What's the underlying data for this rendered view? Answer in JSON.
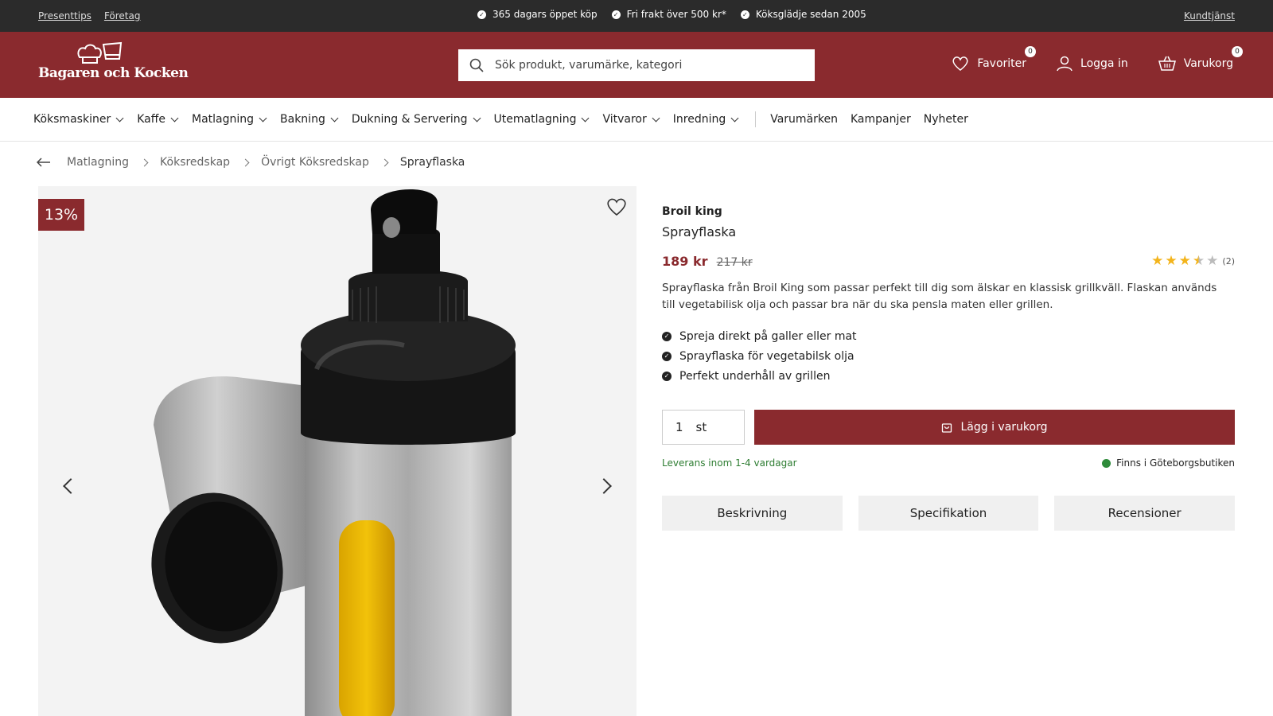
{
  "topbar": {
    "links_left": [
      "Presenttips",
      "Företag"
    ],
    "usps": [
      "365 dagars öppet köp",
      "Fri frakt över 500 kr*",
      "Köksglädje sedan 2005"
    ],
    "link_right": "Kundtjänst"
  },
  "header": {
    "logo_text": "Bagaren och Kocken",
    "search_placeholder": "Sök produkt, varumärke, kategori",
    "favorites_label": "Favoriter",
    "favorites_count": "0",
    "login_label": "Logga in",
    "cart_label": "Varukorg",
    "cart_count": "0"
  },
  "nav": {
    "categories": [
      "Köksmaskiner",
      "Kaffe",
      "Matlagning",
      "Bakning",
      "Dukning & Servering",
      "Utematlagning",
      "Vitvaror",
      "Inredning"
    ],
    "plain_links": [
      "Varumärken",
      "Kampanjer",
      "Nyheter"
    ]
  },
  "breadcrumb": [
    "Matlagning",
    "Köksredskap",
    "Övrigt Köksredskap",
    "Sprayflaska"
  ],
  "gallery": {
    "discount_badge": "13%"
  },
  "product": {
    "brand": "Broil king",
    "title": "Sprayflaska",
    "price": "189 kr",
    "old_price": "217 kr",
    "rating_value": 3.5,
    "rating_max": 5,
    "review_count": "(2)",
    "description": "Sprayflaska från Broil King som passar perfekt till dig som älskar en klassisk grillkväll. Flaskan används till vegetabilisk olja och passar bra när du ska pensla maten eller grillen.",
    "bullets": [
      "Spreja direkt på galler eller mat",
      "Sprayflaska för vegetabilsk olja",
      "Perfekt underhåll av grillen"
    ],
    "quantity": "1",
    "quantity_unit": "st",
    "add_to_cart_label": "Lägg i varukorg",
    "delivery_text": "Leverans inom 1-4 vardagar",
    "stock_text": "Finns i Göteborgsbutiken",
    "tabs": [
      "Beskrivning",
      "Specifikation",
      "Recensioner"
    ]
  },
  "colors": {
    "brand_red": "#8a2a2e",
    "topbar_dark": "#2b2b2b",
    "star_gold": "#f3b41b",
    "in_stock_green": "#2e8b3a"
  }
}
